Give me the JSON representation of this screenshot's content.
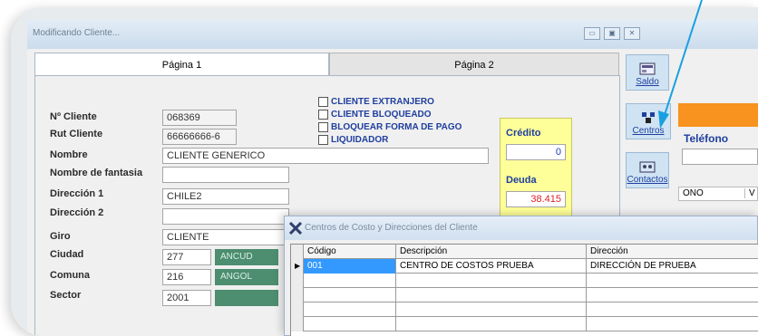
{
  "window": {
    "title": "Modificando Cliente..."
  },
  "tabs": [
    {
      "label": "Página 1"
    },
    {
      "label": "Página 2"
    }
  ],
  "form": {
    "cliente_label": "Nº Cliente",
    "cliente_value": "068369",
    "rut_label": "Rut Cliente",
    "rut_value": "66666666-6",
    "nombre_label": "Nombre",
    "nombre_value": "CLIENTE GENERICO",
    "fantasia_label": "Nombre de fantasia",
    "fantasia_value": "",
    "direccion1_label": "Dirección 1",
    "direccion1_value": "CHILE2",
    "direccion2_label": "Dirección 2",
    "direccion2_value": "",
    "giro_label": "Giro",
    "giro_value": "CLIENTE",
    "ciudad_label": "Ciudad",
    "ciudad_code": "277",
    "ciudad_name": "ANCUD",
    "comuna_label": "Comuna",
    "comuna_code": "216",
    "comuna_name": "ANGOL",
    "sector_label": "Sector",
    "sector_code": "2001"
  },
  "checkboxes": [
    {
      "label": "CLIENTE EXTRANJERO"
    },
    {
      "label": "CLIENTE BLOQUEADO"
    },
    {
      "label": "BLOQUEAR FORMA DE PAGO"
    },
    {
      "label": "LIQUIDADOR"
    }
  ],
  "credit": {
    "credito_label": "Crédito",
    "credito_value": "0",
    "deuda_label": "Deuda",
    "deuda_value": "38.415"
  },
  "side_buttons": [
    {
      "label": "Saldo"
    },
    {
      "label": "Centros"
    },
    {
      "label": "Contactos"
    }
  ],
  "right_panel": {
    "telefono_label": "Teléfono",
    "col_partial": "ONO",
    "col_partial2": "V"
  },
  "dialog": {
    "title": "Centros de Costo y Direcciones del Cliente",
    "columns": [
      "Código",
      "Descripción",
      "Dirección"
    ],
    "rows": [
      {
        "codigo": "001",
        "descripcion": "CENTRO DE COSTOS PRUEBA",
        "direccion": "DIRECCIÓN DE PRUEBA"
      }
    ]
  },
  "colors": {
    "accent": "#1f3f9e",
    "credit_bg": "#ffff99",
    "chip": "#4d8d70",
    "orange": "#f7931e",
    "selection": "#3399ff"
  }
}
